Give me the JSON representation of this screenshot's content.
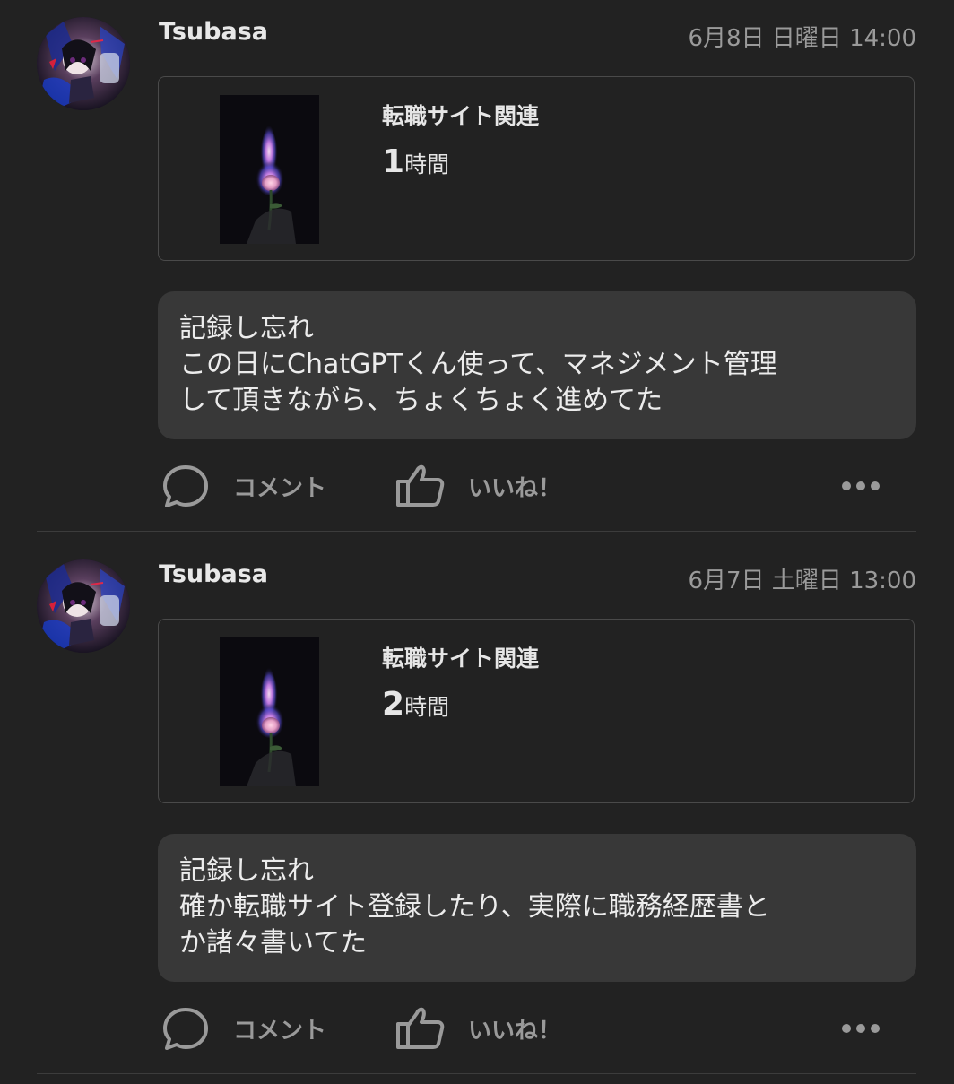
{
  "colors": {
    "background": "#222222",
    "card_border": "#4a4a4a",
    "comment_bg": "#383838",
    "muted_text": "#9a9a9a",
    "text": "#e6e6e6"
  },
  "posts": [
    {
      "user": "Tsubasa",
      "timestamp": "6月8日 日曜日 14:00",
      "record": {
        "category": "転職サイト関連",
        "duration_value": "1",
        "duration_unit": "時間"
      },
      "comment_lines": [
        "記録し忘れ",
        "この日にChatGPTくん使って、マネジメント管理",
        "して頂きながら、ちょくちょく進めてた"
      ],
      "actions": {
        "comment_label": "コメント",
        "like_label": "いいね！",
        "comment_icon": "speech-bubble-icon",
        "like_icon": "thumbs-up-icon",
        "more_icon": "more-dots-icon"
      }
    },
    {
      "user": "Tsubasa",
      "timestamp": "6月7日 土曜日 13:00",
      "record": {
        "category": "転職サイト関連",
        "duration_value": "2",
        "duration_unit": "時間"
      },
      "comment_lines": [
        "記録し忘れ",
        "確か転職サイト登録したり、実際に職務経歴書と",
        "か諸々書いてた"
      ],
      "actions": {
        "comment_label": "コメント",
        "like_label": "いいね！",
        "comment_icon": "speech-bubble-icon",
        "like_icon": "thumbs-up-icon",
        "more_icon": "more-dots-icon"
      }
    }
  ]
}
